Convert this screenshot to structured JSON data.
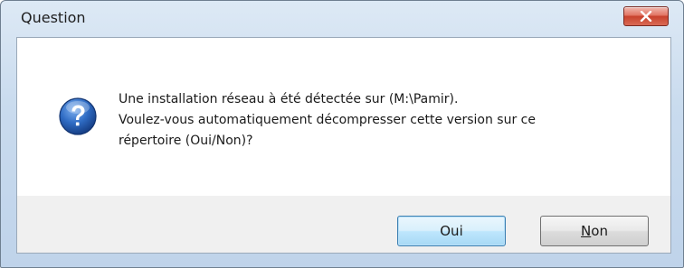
{
  "window": {
    "title": "Question"
  },
  "message": {
    "line1": "Une installation réseau à été détectée sur (M:\\Pamir).",
    "line2": "Voulez-vous automatiquement décompresser cette version sur ce",
    "line3": "répertoire (Oui/Non)?"
  },
  "buttons": {
    "yes_label": "Oui",
    "no_label": "Non"
  },
  "icons": {
    "dialog_icon": "question-icon",
    "close_icon": "close-icon"
  },
  "colors": {
    "close_button": "#d9584a",
    "default_button_border": "#3c7fb1",
    "icon_blue": "#2a63b8"
  }
}
